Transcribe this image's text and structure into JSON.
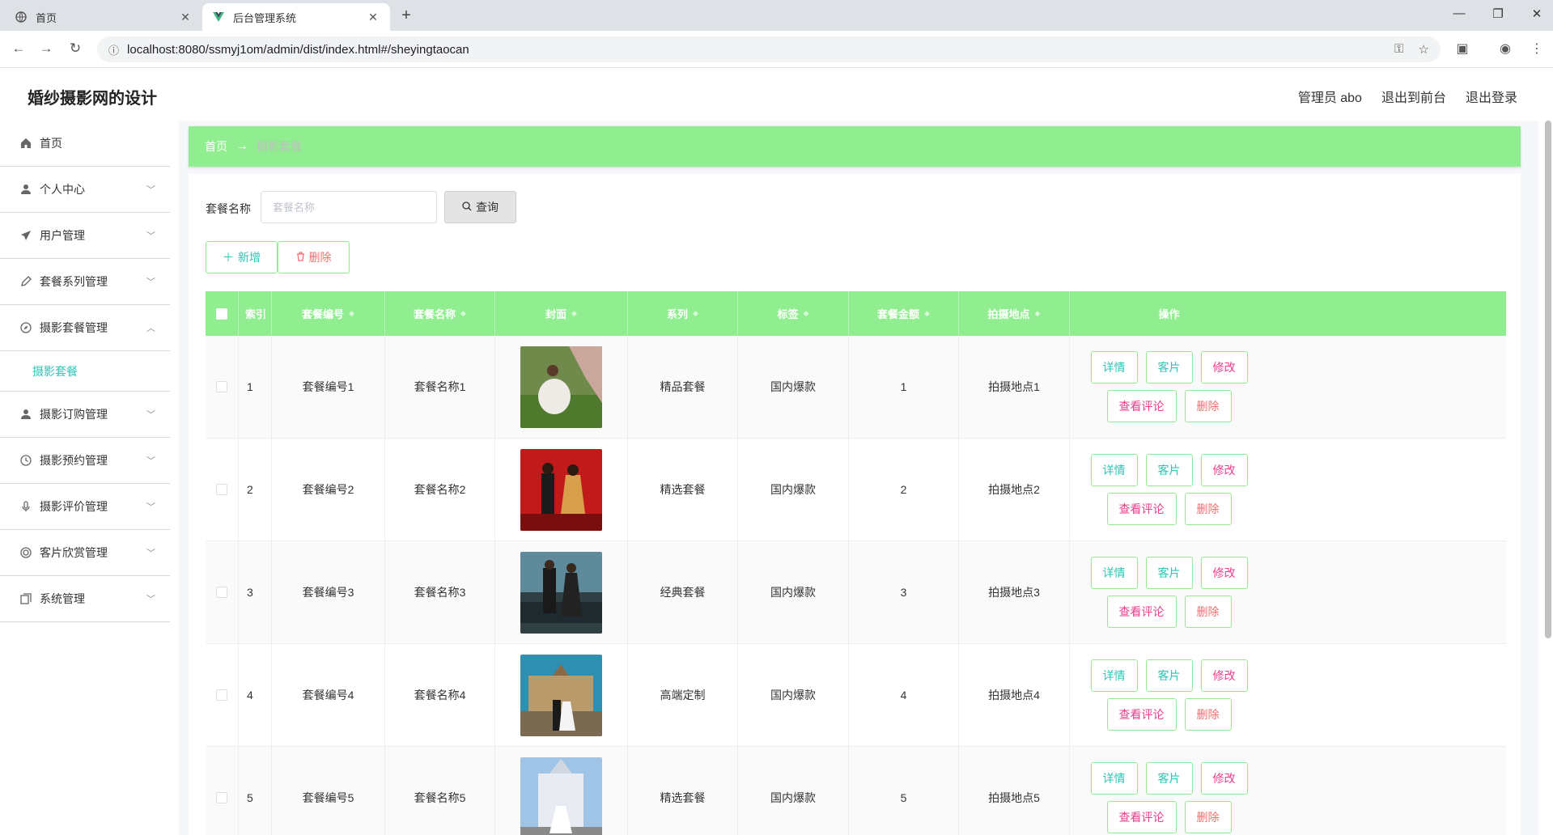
{
  "browser": {
    "tabs": [
      {
        "label": "首页",
        "active": false
      },
      {
        "label": "后台管理系统",
        "active": true
      }
    ],
    "url": "localhost:8080/ssmyj1om/admin/dist/index.html#/sheyingtaocan"
  },
  "header": {
    "brand": "婚纱摄影网的设计",
    "user": "管理员 abo",
    "to_front": "退出到前台",
    "logout": "退出登录"
  },
  "sidebar": {
    "items": [
      {
        "label": "首页",
        "icon": "home-icon",
        "has_children": false
      },
      {
        "label": "个人中心",
        "icon": "user-icon",
        "has_children": true
      },
      {
        "label": "用户管理",
        "icon": "send-icon",
        "has_children": true
      },
      {
        "label": "套餐系列管理",
        "icon": "edit-icon",
        "has_children": true
      },
      {
        "label": "摄影套餐管理",
        "icon": "compass-icon",
        "has_children": true,
        "expanded": true
      },
      {
        "label": "摄影订购管理",
        "icon": "user-icon",
        "has_children": true
      },
      {
        "label": "摄影预约管理",
        "icon": "clock-icon",
        "has_children": true
      },
      {
        "label": "摄影评价管理",
        "icon": "mic-icon",
        "has_children": true
      },
      {
        "label": "客片欣赏管理",
        "icon": "target-icon",
        "has_children": true
      },
      {
        "label": "系统管理",
        "icon": "copy-icon",
        "has_children": true
      }
    ],
    "submenu": "摄影套餐"
  },
  "breadcrumb": {
    "home": "首页",
    "arrow": "→",
    "current": "摄影套餐"
  },
  "search": {
    "label": "套餐名称",
    "placeholder": "套餐名称",
    "button": "查询"
  },
  "actions": {
    "add": "新增",
    "delete": "删除"
  },
  "table": {
    "columns": [
      "索引",
      "套餐编号",
      "套餐名称",
      "封面",
      "系列",
      "标签",
      "套餐金额",
      "拍摄地点",
      "操作"
    ],
    "rows": [
      {
        "index": "1",
        "code": "套餐编号1",
        "name": "套餐名称1",
        "series": "精品套餐",
        "tag": "国内爆款",
        "price": "1",
        "location": "拍摄地点1"
      },
      {
        "index": "2",
        "code": "套餐编号2",
        "name": "套餐名称2",
        "series": "精选套餐",
        "tag": "国内爆款",
        "price": "2",
        "location": "拍摄地点2"
      },
      {
        "index": "3",
        "code": "套餐编号3",
        "name": "套餐名称3",
        "series": "经典套餐",
        "tag": "国内爆款",
        "price": "3",
        "location": "拍摄地点3"
      },
      {
        "index": "4",
        "code": "套餐编号4",
        "name": "套餐名称4",
        "series": "高端定制",
        "tag": "国内爆款",
        "price": "4",
        "location": "拍摄地点4"
      },
      {
        "index": "5",
        "code": "套餐编号5",
        "name": "套餐名称5",
        "series": "精选套餐",
        "tag": "国内爆款",
        "price": "5",
        "location": "拍摄地点5"
      }
    ],
    "row_ops": {
      "detail": "详情",
      "photos": "客片",
      "edit": "修改",
      "comments": "查看评论",
      "delete": "删除"
    }
  },
  "colors": {
    "accent": "#90ee90",
    "teal": "#2ec4b6",
    "danger": "#f56c6c"
  }
}
